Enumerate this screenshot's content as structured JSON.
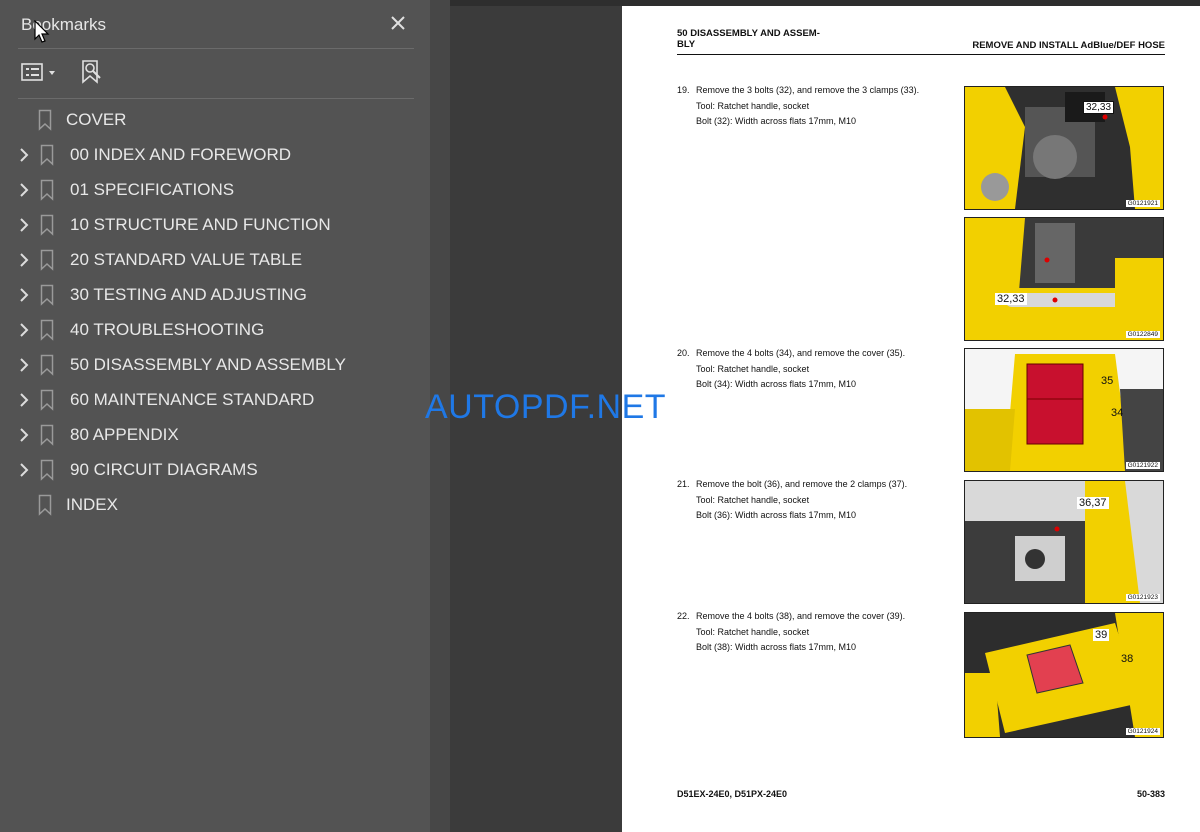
{
  "panel": {
    "title": "Bookmarks",
    "items": [
      {
        "label": "COVER",
        "expandable": false
      },
      {
        "label": "00 INDEX AND FOREWORD",
        "expandable": true
      },
      {
        "label": "01 SPECIFICATIONS",
        "expandable": true
      },
      {
        "label": "10 STRUCTURE AND FUNCTION",
        "expandable": true
      },
      {
        "label": "20 STANDARD VALUE TABLE",
        "expandable": true
      },
      {
        "label": "30 TESTING AND ADJUSTING",
        "expandable": true
      },
      {
        "label": "40 TROUBLESHOOTING",
        "expandable": true
      },
      {
        "label": "50 DISASSEMBLY AND ASSEMBLY",
        "expandable": true
      },
      {
        "label": "60 MAINTENANCE STANDARD",
        "expandable": true
      },
      {
        "label": "80 APPENDIX",
        "expandable": true
      },
      {
        "label": "90 CIRCUIT DIAGRAMS",
        "expandable": true
      },
      {
        "label": "INDEX",
        "expandable": false
      }
    ]
  },
  "page": {
    "header_left_1": "50 DISASSEMBLY AND ASSEM-",
    "header_left_2": "BLY",
    "header_right": "REMOVE AND INSTALL AdBlue/DEF HOSE",
    "steps": [
      {
        "num": "19.",
        "text": "Remove the 3 bolts (32), and remove the 3 clamps (33).",
        "tool": "Tool: Ratchet handle, socket",
        "bolt": "Bolt (32): Width across flats 17mm, M10"
      },
      {
        "num": "20.",
        "text": "Remove the 4 bolts (34), and remove the cover (35).",
        "tool": "Tool: Ratchet handle, socket",
        "bolt": "Bolt (34): Width across flats 17mm, M10"
      },
      {
        "num": "21.",
        "text": "Remove the bolt (36), and remove the 2 clamps (37).",
        "tool": "Tool: Ratchet handle, socket",
        "bolt": "Bolt (36): Width across flats 17mm, M10"
      },
      {
        "num": "22.",
        "text": "Remove the 4 bolts (38), and remove the cover (39).",
        "tool": "Tool: Ratchet handle, socket",
        "bolt": "Bolt (38): Width across flats 17mm, M10"
      }
    ],
    "images": [
      {
        "code": "G0121921",
        "callouts": [
          "32,33"
        ]
      },
      {
        "code": "G0122849",
        "callouts": [
          "32,33"
        ]
      },
      {
        "code": "G0121922",
        "callouts": [
          "35",
          "34"
        ]
      },
      {
        "code": "G0121923",
        "callouts": [
          "36,37"
        ]
      },
      {
        "code": "G0121924",
        "callouts": [
          "39",
          "38"
        ]
      }
    ],
    "footer_left": "D51EX-24E0, D51PX-24E0",
    "footer_right": "50-383"
  },
  "watermark": "AUTOPDF.NET",
  "colors": {
    "panel_bg": "#535353",
    "viewer_bg": "#3b3b3b",
    "watermark": "#1f78e6",
    "machine_yellow": "#f2d000",
    "cover_red": "#c8102e"
  }
}
